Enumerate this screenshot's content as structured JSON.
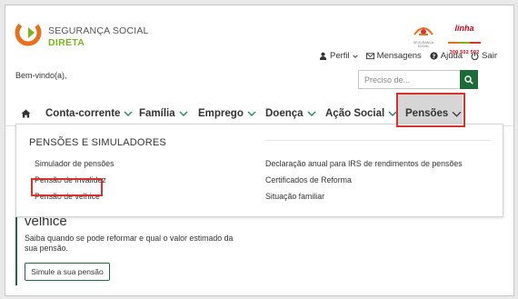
{
  "header": {
    "brand_line1": "SEGURANÇA SOCIAL",
    "brand_line2": "DIRETA",
    "seg_logo_caption": "SEGURANÇA SOCIAL",
    "linha_word": "linha",
    "linha_number": "300 502 502",
    "welcome": "Bem-vindo(a),"
  },
  "util": {
    "perfil": "Perfil",
    "mensagens": "Mensagens",
    "ajuda": "Ajuda",
    "sair": "Sair"
  },
  "search": {
    "placeholder": "Preciso de..."
  },
  "nav": {
    "items": [
      {
        "label": "Conta-corrente"
      },
      {
        "label": "Família"
      },
      {
        "label": "Emprego"
      },
      {
        "label": "Doença"
      },
      {
        "label": "Ação Social"
      },
      {
        "label": "Pensões"
      }
    ]
  },
  "dropdown": {
    "title": "PENSÕES E SIMULADORES",
    "left_links": [
      "Simulador de pensões",
      "Pensão de invalidez",
      "Pensão de velhice"
    ],
    "right_links": [
      "Declaração anual para IRS de rendimentos de pensões",
      "Certificados de Reforma",
      "Situação familiar"
    ]
  },
  "hero": {
    "title": "velhice",
    "description": "Saiba quando se pode reformar e qual o valor estimado da sua pensão.",
    "button": "Simule a sua pensão"
  },
  "colors": {
    "brand_green": "#7ab51d",
    "dark_green": "#1e6b3a",
    "highlight_red": "#d9312b",
    "brand_orange": "#e8701c"
  }
}
